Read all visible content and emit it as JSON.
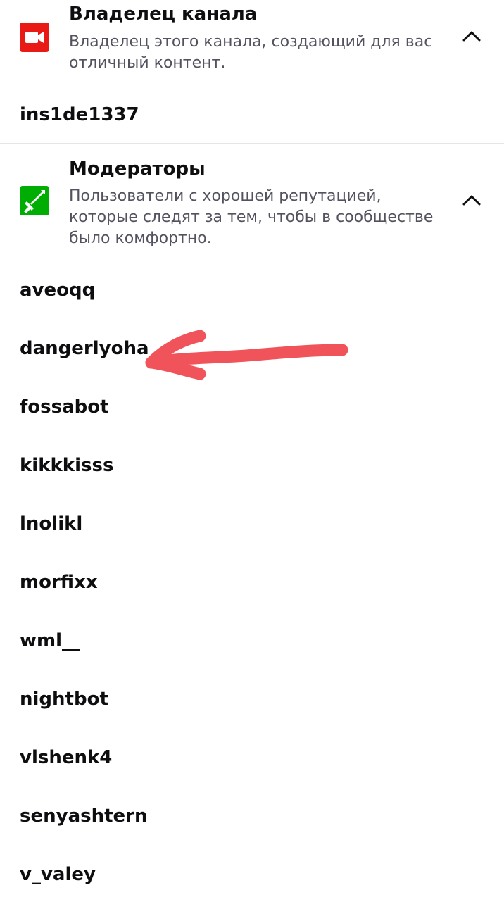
{
  "owner_section": {
    "title": "Владелец канала",
    "description": "Владелец этого канала, создающий для вас отличный контент.",
    "icon": "camera-icon",
    "icon_color": "#e91916",
    "collapse_icon": "chevron-up-icon",
    "users": [
      "ins1de1337"
    ]
  },
  "moderators_section": {
    "title": "Модераторы",
    "description": "Пользователи с хорошей репутацией, которые следят за тем, чтобы в сообществе было комфортно.",
    "icon": "sword-icon",
    "icon_color": "#00ad03",
    "collapse_icon": "chevron-up-icon",
    "users": [
      "aveoqq",
      "dangerlyoha",
      "fossabot",
      "kikkkisss",
      "lnolikl",
      "morfixx",
      "wml__",
      "nightbot",
      "vlshenk4",
      "senyashtern",
      "v_valey"
    ]
  },
  "annotation": {
    "type": "hand-drawn-arrow",
    "color": "#f0545a",
    "points_to": "dangerlyoha"
  }
}
